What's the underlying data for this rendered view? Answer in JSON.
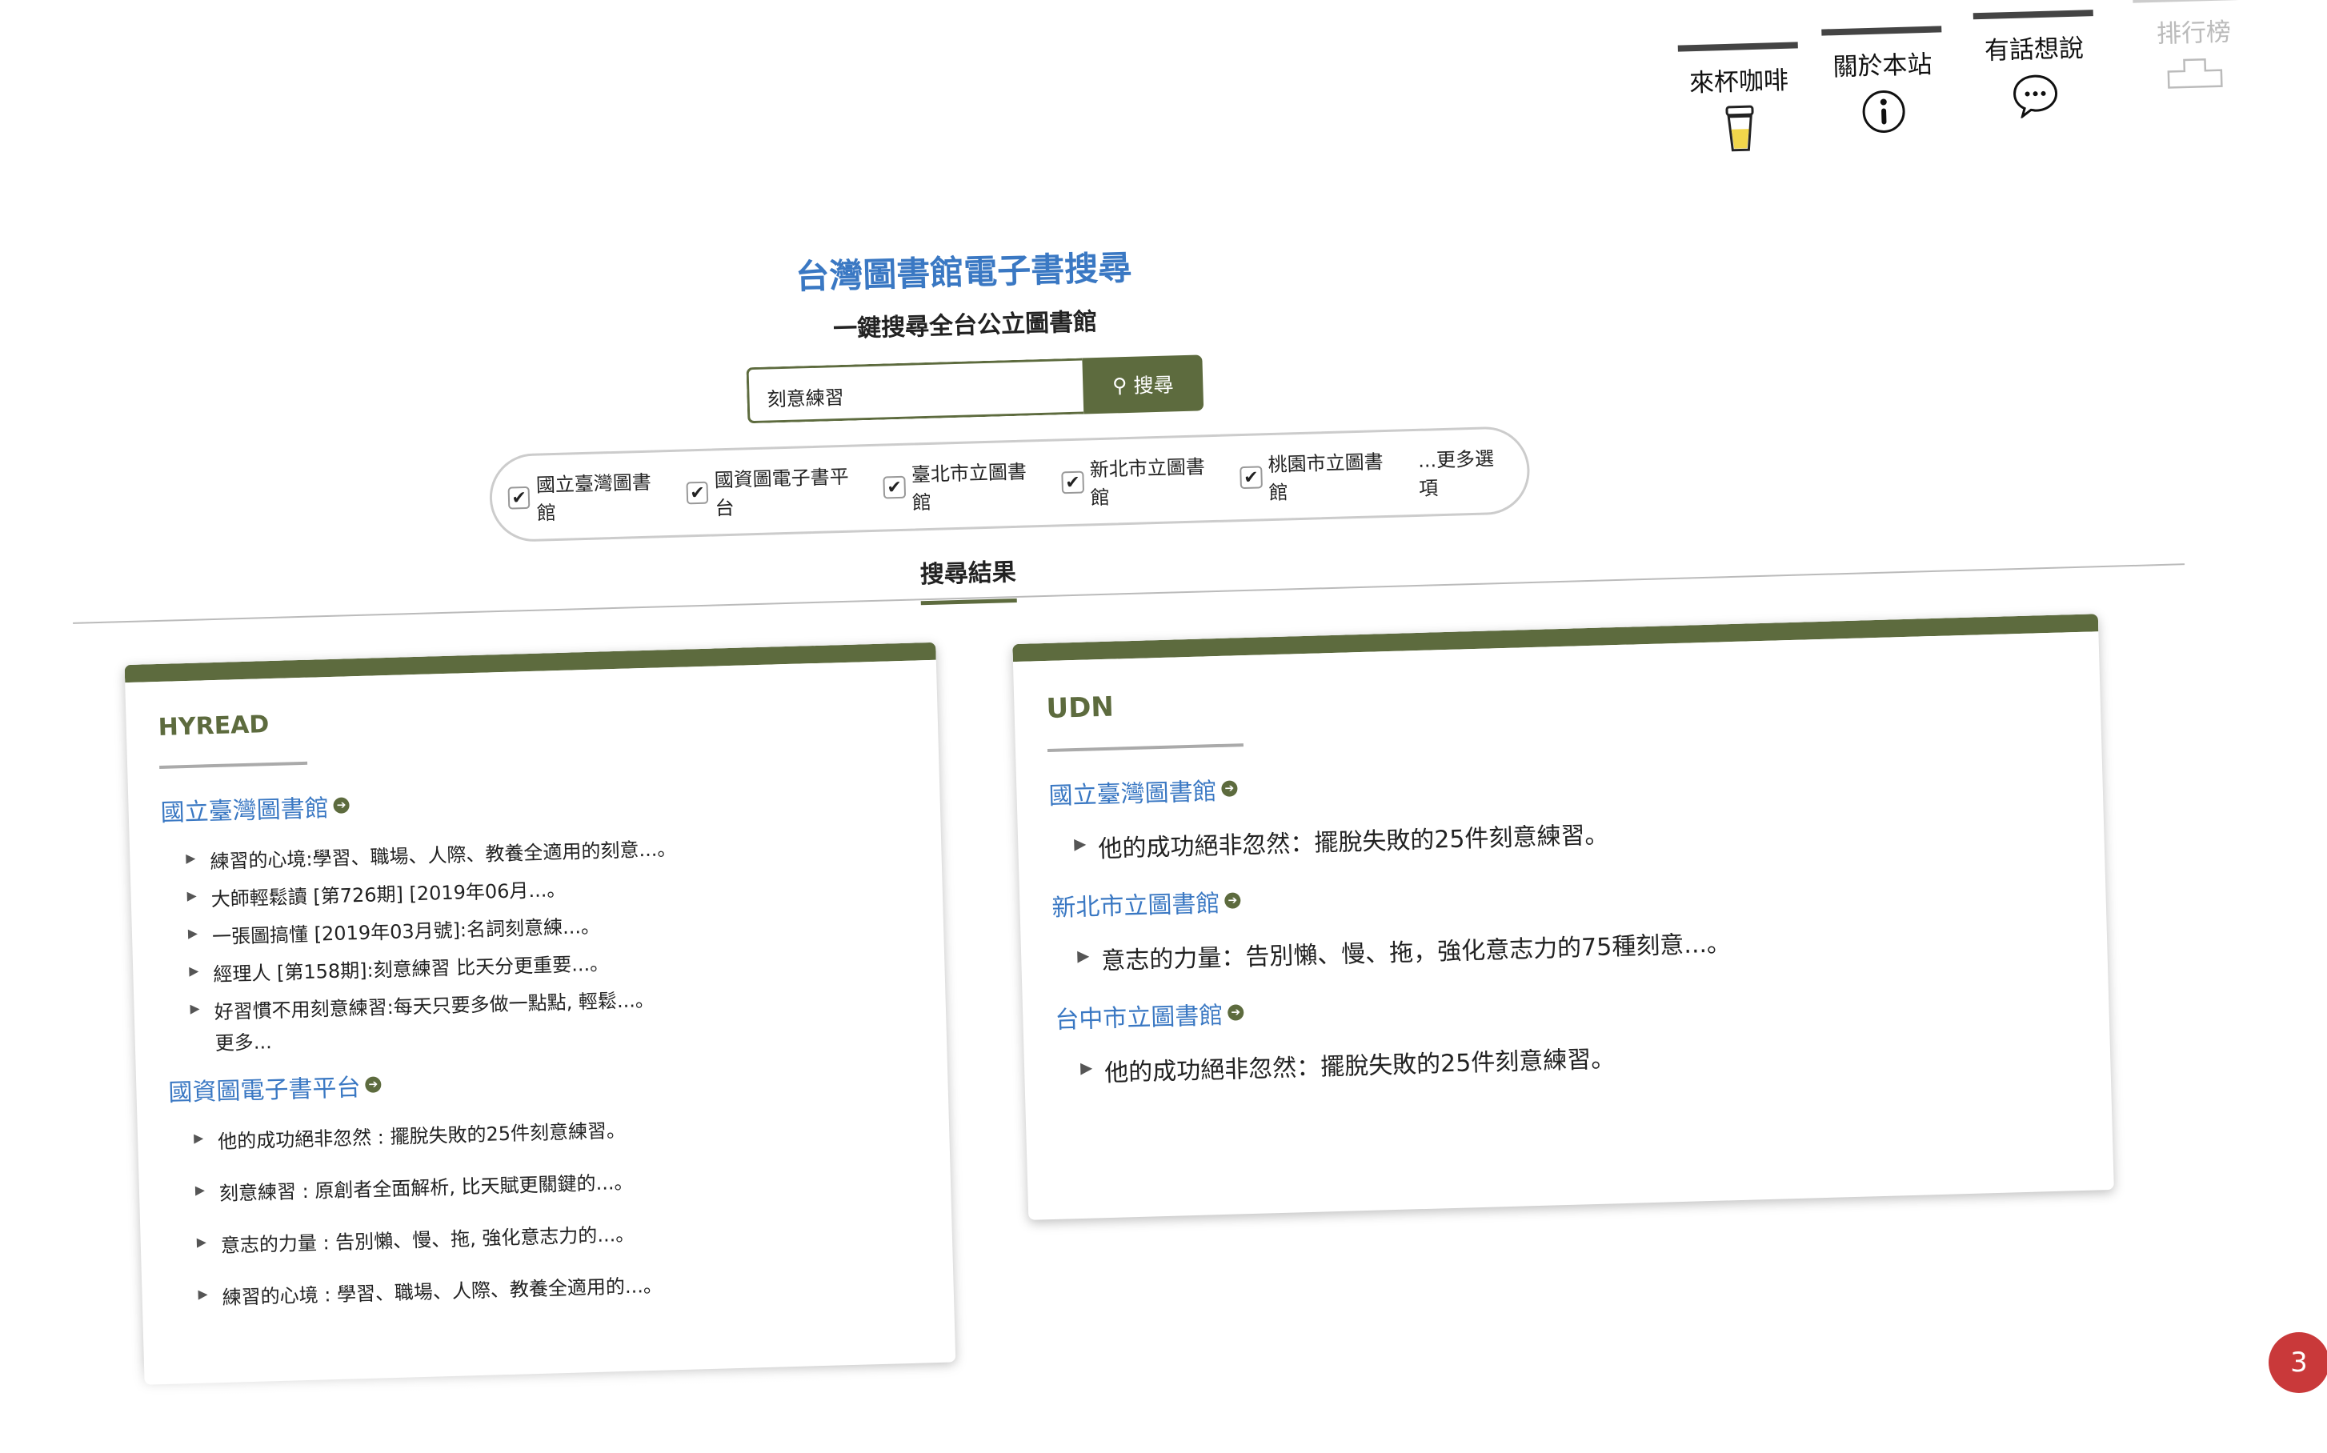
{
  "nav": [
    {
      "label": "來杯咖啡",
      "icon": "coffee-cup-icon"
    },
    {
      "label": "關於本站",
      "icon": "info-icon"
    },
    {
      "label": "有話想說",
      "icon": "speech-bubble-icon"
    },
    {
      "label": "排行榜",
      "icon": "podium-icon"
    }
  ],
  "header": {
    "title": "台灣圖書館電子書搜尋",
    "subtitle": "一鍵搜尋全台公立圖書館"
  },
  "search": {
    "value": "刻意練習",
    "button": "搜尋"
  },
  "filters": [
    {
      "label": "國立臺灣圖書館",
      "checked": true
    },
    {
      "label": "國資圖電子書平台",
      "checked": true
    },
    {
      "label": "臺北市立圖書館",
      "checked": true
    },
    {
      "label": "新北市立圖書館",
      "checked": true
    },
    {
      "label": "桃園市立圖書館",
      "checked": true
    }
  ],
  "more_options": "...更多選項",
  "tab": "搜尋結果",
  "hyread": {
    "title": "HYREAD",
    "libs": [
      {
        "name": "國立臺灣圖書館",
        "items": [
          "練習的心境:學習、職場、人際、教養全適用的刻意...。",
          "大師輕鬆讀 [第726期] [2019年06月...。",
          "一張圖搞懂 [2019年03月號]:名詞刻意練...。",
          "經理人 [第158期]:刻意練習 比天分更重要...。",
          "好習慣不用刻意練習:每天只要多做一點點, 輕鬆...。"
        ],
        "more": "更多..."
      },
      {
        "name": "國資圖電子書平台",
        "items": [
          "他的成功絕非忽然 : 擺脫失敗的25件刻意練習。",
          "刻意練習 : 原創者全面解析, 比天賦更關鍵的...。",
          "意志的力量 : 告別懶、慢、拖, 強化意志力的...。",
          "練習的心境 : 學習、職場、人際、教養全適用的...。"
        ]
      }
    ]
  },
  "udn": {
    "title": "UDN",
    "libs": [
      {
        "name": "國立臺灣圖書館",
        "items": [
          "他的成功絕非忽然：擺脫失敗的25件刻意練習。"
        ]
      },
      {
        "name": "新北市立圖書館",
        "items": [
          "意志的力量：告別懶、慢、拖，強化意志力的75種刻意...。"
        ]
      },
      {
        "name": "台中市立圖書館",
        "items": [
          "他的成功絕非忽然：擺脫失敗的25件刻意練習。"
        ]
      }
    ]
  },
  "badge": "3",
  "colors": {
    "accent": "#5d6b3e",
    "link": "#3a78c3",
    "badge": "#c9393a"
  }
}
